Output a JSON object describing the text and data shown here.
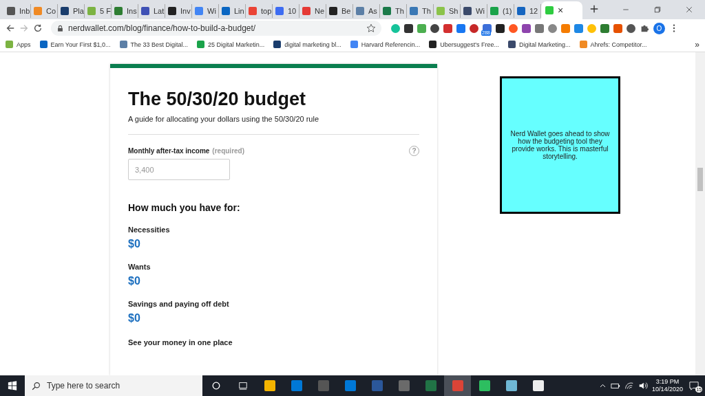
{
  "tabs": [
    {
      "label": "Inb",
      "selected": false
    },
    {
      "label": "Co",
      "selected": false
    },
    {
      "label": "Pla",
      "selected": false
    },
    {
      "label": "5 F",
      "selected": false
    },
    {
      "label": "Ins",
      "selected": false
    },
    {
      "label": "Lat",
      "selected": false
    },
    {
      "label": "Inv",
      "selected": false
    },
    {
      "label": "Wi",
      "selected": false
    },
    {
      "label": "Lin",
      "selected": false
    },
    {
      "label": "top",
      "selected": false
    },
    {
      "label": "10",
      "selected": false
    },
    {
      "label": "Ne",
      "selected": false
    },
    {
      "label": "Be",
      "selected": false
    },
    {
      "label": "As",
      "selected": false
    },
    {
      "label": "Th",
      "selected": false
    },
    {
      "label": "Th",
      "selected": false
    },
    {
      "label": "Sh",
      "selected": false
    },
    {
      "label": "Wi",
      "selected": false
    },
    {
      "label": "(1)",
      "selected": false
    },
    {
      "label": "12",
      "selected": false
    },
    {
      "selected": true
    }
  ],
  "tab_close": "×",
  "toolbar": {
    "url": "nerdwallet.com/blog/finance/how-to-build-a-budget/",
    "forward_disabled": true,
    "extension_badge": "288",
    "profile_initial": "O"
  },
  "bookmarks": [
    {
      "label": "Apps"
    },
    {
      "label": "Earn Your First $1,0..."
    },
    {
      "label": "The 33 Best Digital..."
    },
    {
      "label": "25 Digital Marketin..."
    },
    {
      "label": "digital marketing bl..."
    },
    {
      "label": "Harvard Referencin..."
    },
    {
      "label": "Ubersuggest's Free..."
    },
    {
      "label": "Digital Marketing..."
    },
    {
      "label": "Ahrefs: Competitor..."
    }
  ],
  "bookmarks_overflow": "»",
  "budget": {
    "title": "The 50/30/20 budget",
    "subtitle": "A guide for allocating your dollars using the 50/30/20 rule",
    "income_label": "Monthly after-tax income",
    "income_note": "(required)",
    "help": "?",
    "income_placeholder": "3,400",
    "heading": "How much you have for:",
    "categories": [
      {
        "label": "Necessities",
        "amount": "$0"
      },
      {
        "label": "Wants",
        "amount": "$0"
      },
      {
        "label": "Savings and paying off debt",
        "amount": "$0"
      }
    ],
    "next_heading": "See your money in one place"
  },
  "note": "Nerd Wallet goes ahead to show how the budgeting tool they provide works. This is masterful storytelling.",
  "taskbar": {
    "search_placeholder": "Type here to search",
    "apps": [
      {
        "selected": false
      },
      {
        "selected": false
      },
      {
        "selected": false
      },
      {
        "selected": false
      },
      {
        "selected": false
      },
      {
        "selected": false
      },
      {
        "selected": false
      },
      {
        "selected": true
      },
      {
        "selected": false
      },
      {
        "selected": false
      },
      {
        "selected": false
      }
    ],
    "time": "3:19 PM",
    "date": "10/14/2020",
    "notifications": "15"
  }
}
